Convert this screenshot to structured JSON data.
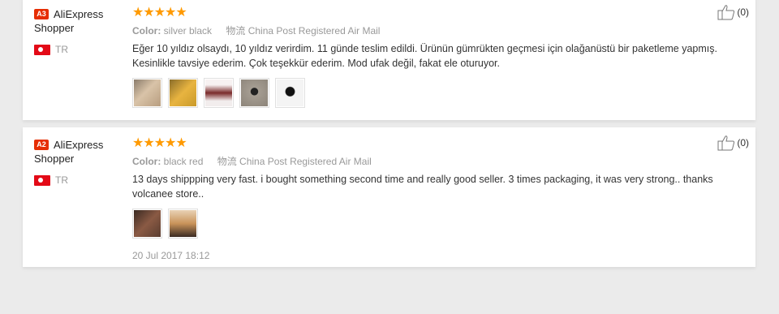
{
  "reviews": [
    {
      "level": "A3",
      "username": "AliExpress Shopper",
      "country": "TR",
      "stars": "★★★★★",
      "color_label": "Color:",
      "color_value": "silver black",
      "shipping": "物流 China Post Registered Air Mail",
      "text": "Eğer 10 yıldız olsaydı, 10 yıldız verirdim. 11 günde teslim edildi. Ürünün gümrükten geçmesi için olağanüstü bir paketleme yapmış. Kesinlikle tavsiye ederim. Çok teşekkür ederim. Mod ufak değil, fakat ele oturuyor.",
      "likes": "(0)",
      "photo_colors": [
        "#b8a590",
        "#d4a437",
        "#f0eaea",
        "#a39b8f",
        "#f3f3f3"
      ]
    },
    {
      "level": "A2",
      "username": "AliExpress Shopper",
      "country": "TR",
      "stars": "★★★★★",
      "color_label": "Color:",
      "color_value": "black red",
      "shipping": "物流 China Post Registered Air Mail",
      "text": "13 days shippping very fast. i bought something second time and really good seller. 3 times packaging, it was very strong.. thanks volcanee store..",
      "likes": "(0)",
      "date": "20 Jul 2017 18:12",
      "photo_colors": [
        "#6a4a3c",
        "#c9935a"
      ]
    }
  ]
}
